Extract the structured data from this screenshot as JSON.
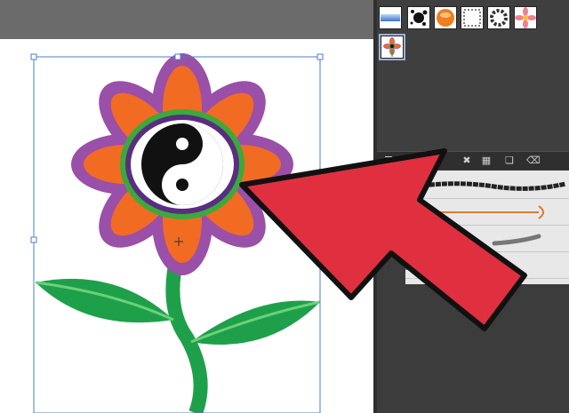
{
  "colors": {
    "canvas": "#ffffff",
    "panel_bg": "#3c3c3c",
    "arrow_red": "#e03040",
    "petal_orange": "#f26b22",
    "petal_purple": "#9a4fa8",
    "ring_green": "#3aaa3a",
    "ring_purple": "#5a2d82",
    "leaf_green": "#1ea04a"
  },
  "symbols_panel": {
    "items": [
      {
        "icon": "blue-bar-symbol-icon"
      },
      {
        "icon": "ink-splat-symbol-icon"
      },
      {
        "icon": "orange-sphere-symbol-icon"
      },
      {
        "icon": "dotted-frame-symbol-icon"
      },
      {
        "icon": "ring-symbol-icon"
      },
      {
        "icon": "pink-flower-symbol-icon"
      },
      {
        "icon": "orange-flower-symbol-icon"
      }
    ]
  },
  "brushes_panel": {
    "rows": [
      {
        "icon": "charcoal-brush-icon"
      },
      {
        "icon": "arrow-art-brush-icon"
      },
      {
        "icon": "smudge-brush-icon"
      },
      {
        "icon": "pattern-brush-icon"
      }
    ]
  }
}
